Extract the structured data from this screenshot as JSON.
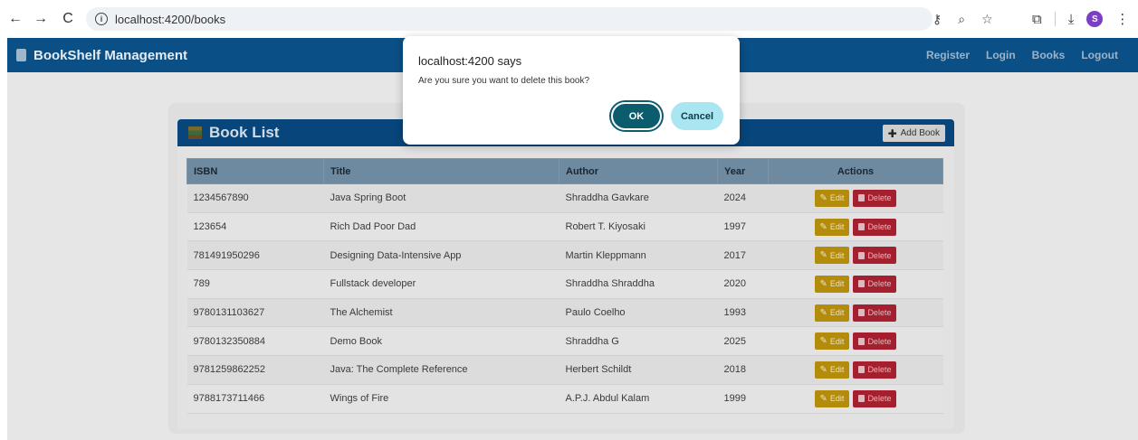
{
  "browser": {
    "url": "localhost:4200/books",
    "back_icon": "←",
    "forward_icon": "→",
    "reload_icon": "C",
    "profile_initial": "S"
  },
  "navbar": {
    "brand": "BookShelf Management",
    "links": [
      "Register",
      "Login",
      "Books",
      "Logout"
    ]
  },
  "card": {
    "title": "Book List",
    "add_button": "Add Book"
  },
  "table": {
    "headers": [
      "ISBN",
      "Title",
      "Author",
      "Year",
      "Actions"
    ],
    "rows": [
      {
        "isbn": "1234567890",
        "title": "Java Spring Boot",
        "author": "Shraddha Gavkare",
        "year": "2024"
      },
      {
        "isbn": "123654",
        "title": "Rich Dad Poor Dad",
        "author": "Robert T. Kiyosaki",
        "year": "1997"
      },
      {
        "isbn": "781491950296",
        "title": "Designing Data-Intensive App",
        "author": "Martin Kleppmann",
        "year": "2017"
      },
      {
        "isbn": "789",
        "title": "Fullstack developer",
        "author": "Shraddha Shraddha",
        "year": "2020"
      },
      {
        "isbn": "9780131103627",
        "title": "The Alchemist",
        "author": "Paulo Coelho",
        "year": "1993"
      },
      {
        "isbn": "9780132350884",
        "title": "Demo Book",
        "author": "Shraddha G",
        "year": "2025"
      },
      {
        "isbn": "9781259862252",
        "title": "Java: The Complete Reference",
        "author": "Herbert Schildt",
        "year": "2018"
      },
      {
        "isbn": "9788173711466",
        "title": "Wings of Fire",
        "author": "A.P.J. Abdul Kalam",
        "year": "1999"
      }
    ],
    "edit_label": "Edit",
    "delete_label": "Delete"
  },
  "dialog": {
    "title": "localhost:4200 says",
    "message": "Are you sure you want to delete this book?",
    "ok_label": "OK",
    "cancel_label": "Cancel"
  },
  "colors": {
    "navbar": "#0a4f86",
    "ok": "#0b5d6e",
    "cancel": "#a9e6f2",
    "edit": "#b48c0c",
    "delete": "#a4202e"
  }
}
